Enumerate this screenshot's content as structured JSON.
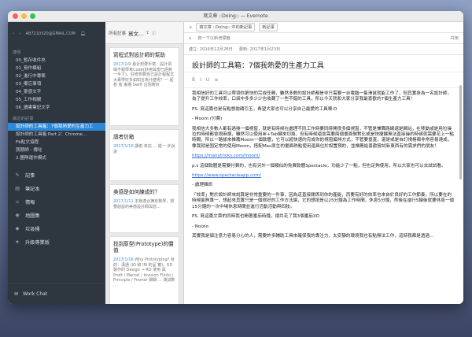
{
  "window": {
    "title": "寫文章 ::Doing:: — Evernote"
  },
  "sidebar": {
    "email": "AB7210320@GMAIL.COM",
    "shortcuts_heading": "捷徑",
    "shortcuts": [
      "00_暫存收件夾",
      "01_寫作模組",
      "02_進行中專案",
      "03_備忘事項",
      "04_靈感文字",
      "05_工作相關",
      "06_讀書筆記文字"
    ],
    "recent_heading": "最近的記事",
    "recent": [
      "設計師的工具箱：7個我熱愛的生產力工",
      "設計師的工具箱 Part 2：Chrome...",
      "Fb貼文協程",
      "我期師 - 傳化",
      "2.團隊運作模式"
    ],
    "nav": [
      {
        "icon": "✎",
        "label": "記事"
      },
      {
        "icon": "▤",
        "label": "筆記本"
      },
      {
        "icon": "⌂",
        "label": "情報"
      },
      {
        "icon": "◉",
        "label": "地圖集"
      },
      {
        "icon": "◆",
        "label": "垃圾桶"
      },
      {
        "icon": "★",
        "label": "升級專業版"
      }
    ],
    "work_chat": "Work Chat"
  },
  "notelist": {
    "filter": "所有記事",
    "notebook": "寫文...",
    "cards": [
      {
        "title": "寫程式對設計師的幫助",
        "date": "2017/1/9",
        "snippet": "最近想要手寫：設計領域不錯學寫Code(好用與當已經寫一半了)，好奇想要自己設計程程式大專學好多如如言為什麼呢？一 起甚 客 鬼描 Swift 這個寫好"
      },
      {
        "title": "讀者信箱",
        "date": "2017/1/10",
        "snippet": "讀者 來信 ... 進一 步說說"
      },
      {
        "title": "美感是如何練成的？",
        "date": "2017/1/11",
        "snippet": "本篇適合摘有數學，想要創設的美感設計師與您..."
      },
      {
        "title": "找到原型(Prototype)的價值",
        "date": "2017/1/16",
        "snippet": "Why Prototyping? 目的：溝通 (IO 和 IM 的呈 實)；RD 製作的 Design → RD 使用 與 Prott / Marvel / Invision Flinto / Principle / Framer 聊聊 ... 測試數 .."
      }
    ]
  },
  "editor": {
    "notebook_label": "寫文章 ::Doing:: 中的新記事",
    "new_note": "新記事",
    "tag_hint": "按一下以新增標籤",
    "share": "共用",
    "created": "建立: 2016年12月28日",
    "updated": "更新: 2017年1月23日",
    "heading": "設計師的工具箱：7個我熱愛的生產力工具",
    "intro": "我相信好的工具可以帶領你更快的完成任務，雖然多數的設計師都是非只需要一台電腦一隻滑鼠就能工作了，但其實身為一名設計師，為了提升工作效率，口袋中多多少少也收藏了一些不錯的工具，所以今天就和大家分享我最喜歡的7個生產力工具！",
    "ps1": "PS. 寫這篇也是有點想拋磚引玉，希望大家也可以分享自己最愛的工具噢:D",
    "moom_h": "- Moom (付費)",
    "moom": "我相信大多數人都有過換一個視窗，就是有時候在處理不同工作時要同時開很多個視窗，不管是兼職路線還是網站，在移動或是用拉操拉的時候都會很麻煩，雖然可以使用⌘+Tab鍵來切換，但有時候還會需要兩個畫面做對比或是快捷鍵無法直接操的時候就需要花上一點時間，所以一路拔來推薦Moom一個軟體，它可以超快速的完成你的視窗編排方式，不管要垂直，還是或是自訂視格都非常容易達成，像我就是固定常的使用Moom，搭配Mac原生的畫面熱點使用還具位於設置預的，並推薦給喜歡嘗試新東西有的需求們的朋友！",
    "moom_url": "https://manytricks.com/moom/",
    "spectacle": "p.s 這個軟體是需要付費的，也有另外一個類似的免費軟體Spectacle，功能少了一點，但也足夠使用，所以大家也可以去試試看。",
    "spectacle_url": "https://www.spectacleapp.com/",
    "noise_h": "- 處理雜訊",
    "noise": "「效率」對於設計師來說算是非常重要的一件事，因為這直接關係到你的產能，而要有好的效率也來自於良好的工作節奏，所以要在的時候能夠專一，想起來其實只是一個很好的工作方法論，它的想按是以25分鐘為工作時間，休息5分鐘，然後在進行5輪後就要休息一個15分鐘的一次中場休息時間並進行活動活動與四肢。",
    "ps2": "PS. 寫這篇文章的同時我也開著番茄時鐘，總共花了我3個番茄XD",
    "noizio_h": "- Noizio",
    "noizio": "其實我是個注意力容易分心的人，需要許多輔助工具來確保我的專注力，太安靜的環境我也有點無法工作，這時我都是透過…"
  }
}
